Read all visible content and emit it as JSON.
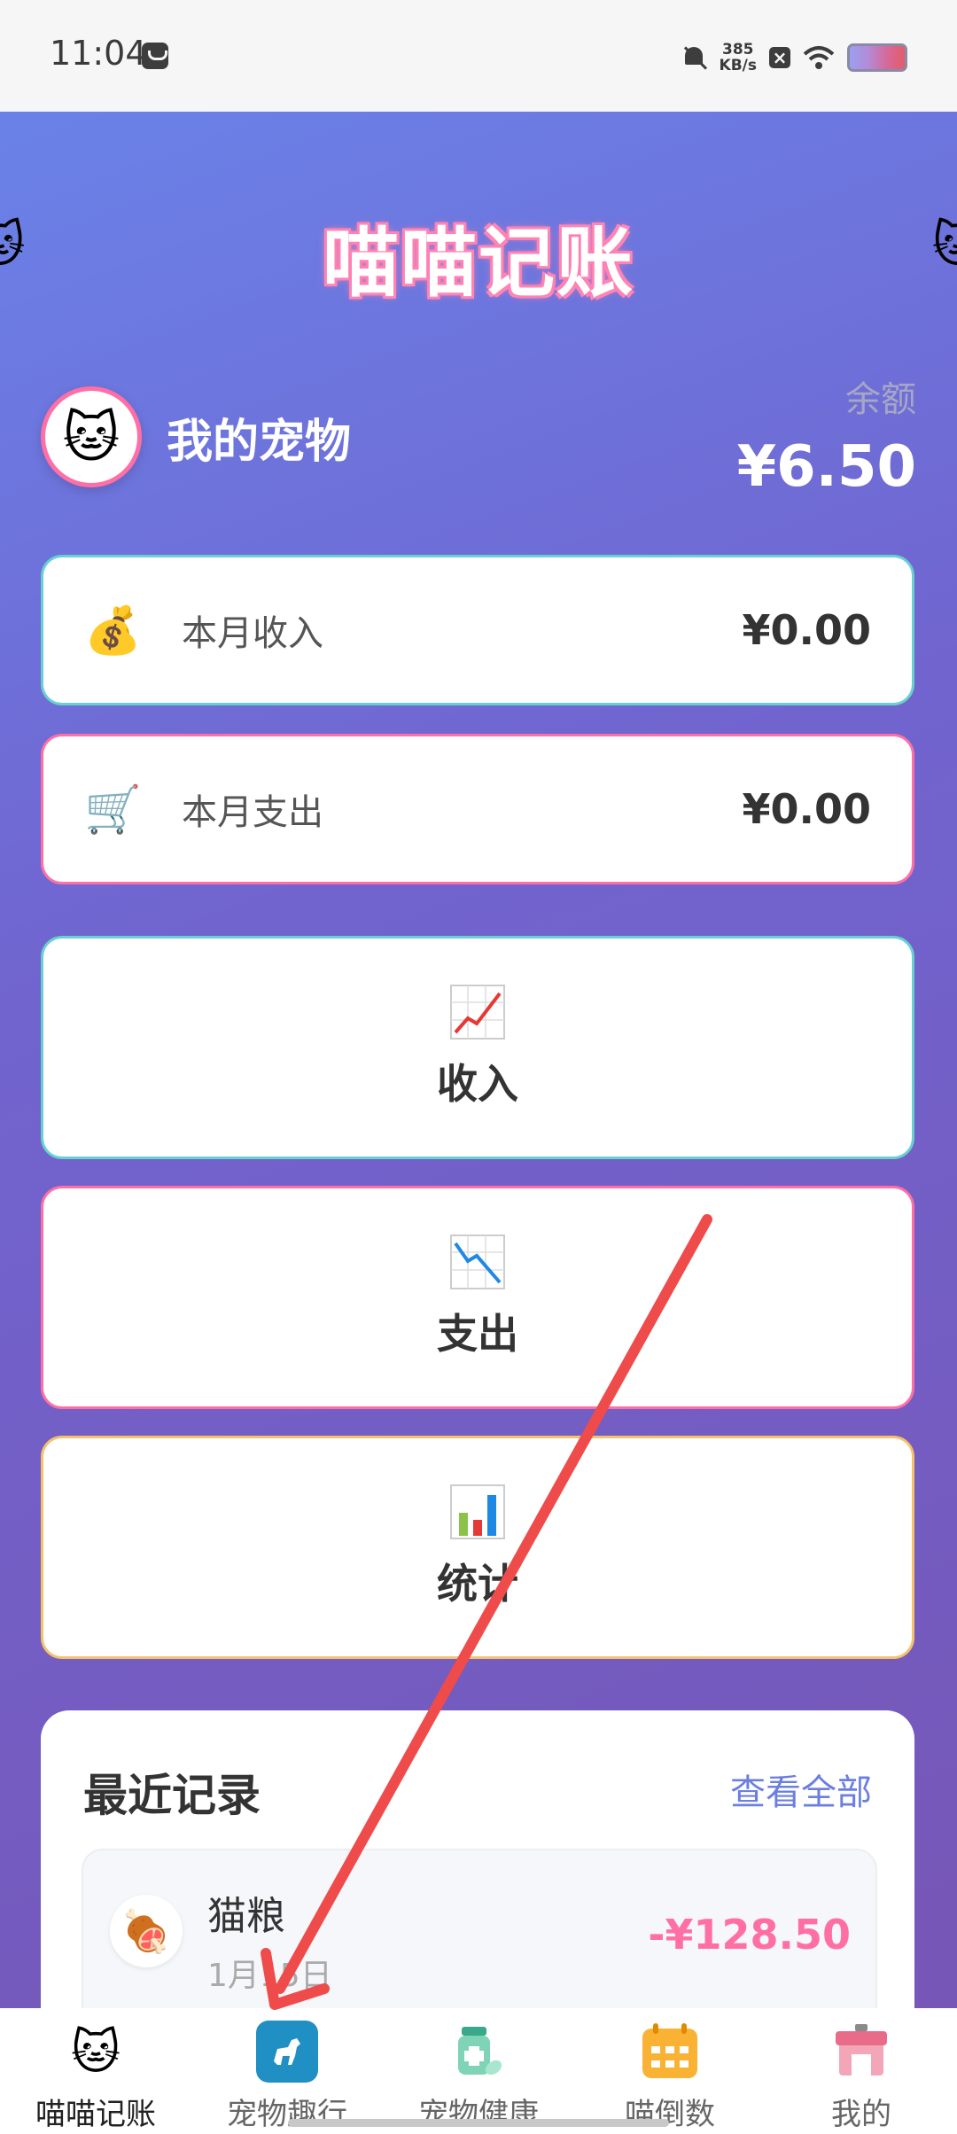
{
  "status_bar": {
    "time": "11:04",
    "net_speed_value": "385",
    "net_speed_unit": "KB/s",
    "icons": [
      "notification-icon",
      "mute-icon",
      "close-icon",
      "wifi-icon",
      "battery-icon"
    ]
  },
  "app": {
    "title": "喵喵记账",
    "side_icons": [
      "cat-face-icon",
      "cat-face-icon"
    ]
  },
  "pet": {
    "avatar_icon": "cat-face-icon",
    "name": "我的宠物",
    "balance_label": "余额",
    "balance_value": "¥6.50"
  },
  "summary": {
    "income": {
      "icon": "money-bag-icon",
      "label": "本月收入",
      "amount": "¥0.00"
    },
    "expense": {
      "icon": "shopping-cart-icon",
      "label": "本月支出",
      "amount": "¥0.00"
    }
  },
  "actions": [
    {
      "icon": "chart-increasing-icon",
      "label": "收入"
    },
    {
      "icon": "chart-decreasing-icon",
      "label": "支出"
    },
    {
      "icon": "bar-chart-icon",
      "label": "统计"
    }
  ],
  "recent": {
    "title": "最近记录",
    "view_all": "查看全部",
    "records": [
      {
        "icon": "meat-icon",
        "name": "猫粮",
        "date": "1月15日",
        "amount": "-¥128.50"
      }
    ]
  },
  "tabs": [
    {
      "icon": "cat-avatar-icon",
      "label": "喵喵记账",
      "active": true
    },
    {
      "icon": "dog-walk-icon",
      "label": "宠物趣行",
      "active": false
    },
    {
      "icon": "medicine-icon",
      "label": "宠物健康",
      "active": false
    },
    {
      "icon": "calendar-icon",
      "label": "喵倒数",
      "active": false
    },
    {
      "icon": "store-icon",
      "label": "我的",
      "active": false
    }
  ],
  "colors": {
    "gradient_start": "#6a82e8",
    "gradient_end": "#7656b6",
    "accent_pink": "#ff6fa5",
    "accent_teal": "#68d0d0",
    "accent_orange": "#f5c16b",
    "link_blue": "#6b7fe0",
    "annotation_arrow": "#ef4b4b"
  }
}
